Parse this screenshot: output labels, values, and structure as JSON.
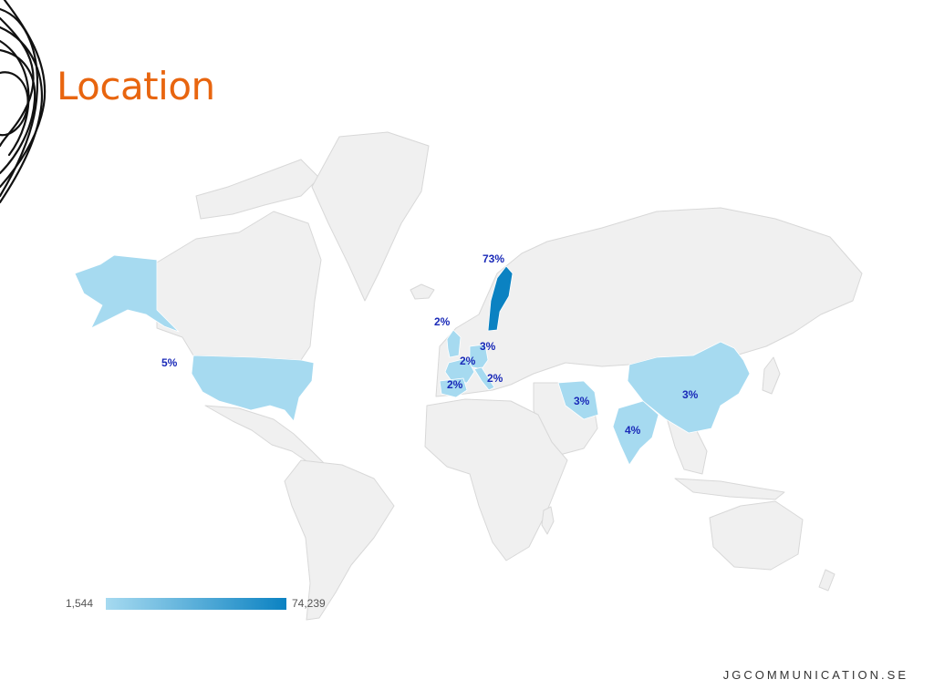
{
  "title": "Location",
  "footer": "JGCOMMUNICATION.SE",
  "colors": {
    "title": "#e8650f",
    "land": "#f0f0f0",
    "border": "#d8d8d8",
    "low": "#a6daf0",
    "high": "#0b82c2",
    "label": "#1a2ab8"
  },
  "legend": {
    "min": "1,544",
    "max": "74,239"
  },
  "chart_data": {
    "type": "choropleth",
    "regions": [
      {
        "name": "Sweden",
        "value": 73,
        "label": "73%"
      },
      {
        "name": "United States",
        "value": 5,
        "label": "5%"
      },
      {
        "name": "India",
        "value": 4,
        "label": "4%"
      },
      {
        "name": "Iran",
        "value": 3,
        "label": "3%"
      },
      {
        "name": "China",
        "value": 3,
        "label": "3%"
      },
      {
        "name": "Germany",
        "value": 3,
        "label": "3%"
      },
      {
        "name": "United Kingdom",
        "value": 2,
        "label": "2%"
      },
      {
        "name": "France",
        "value": 2,
        "label": "2%"
      },
      {
        "name": "Spain",
        "value": 2,
        "label": "2%"
      },
      {
        "name": "Italy",
        "value": 2,
        "label": "2%"
      }
    ]
  }
}
